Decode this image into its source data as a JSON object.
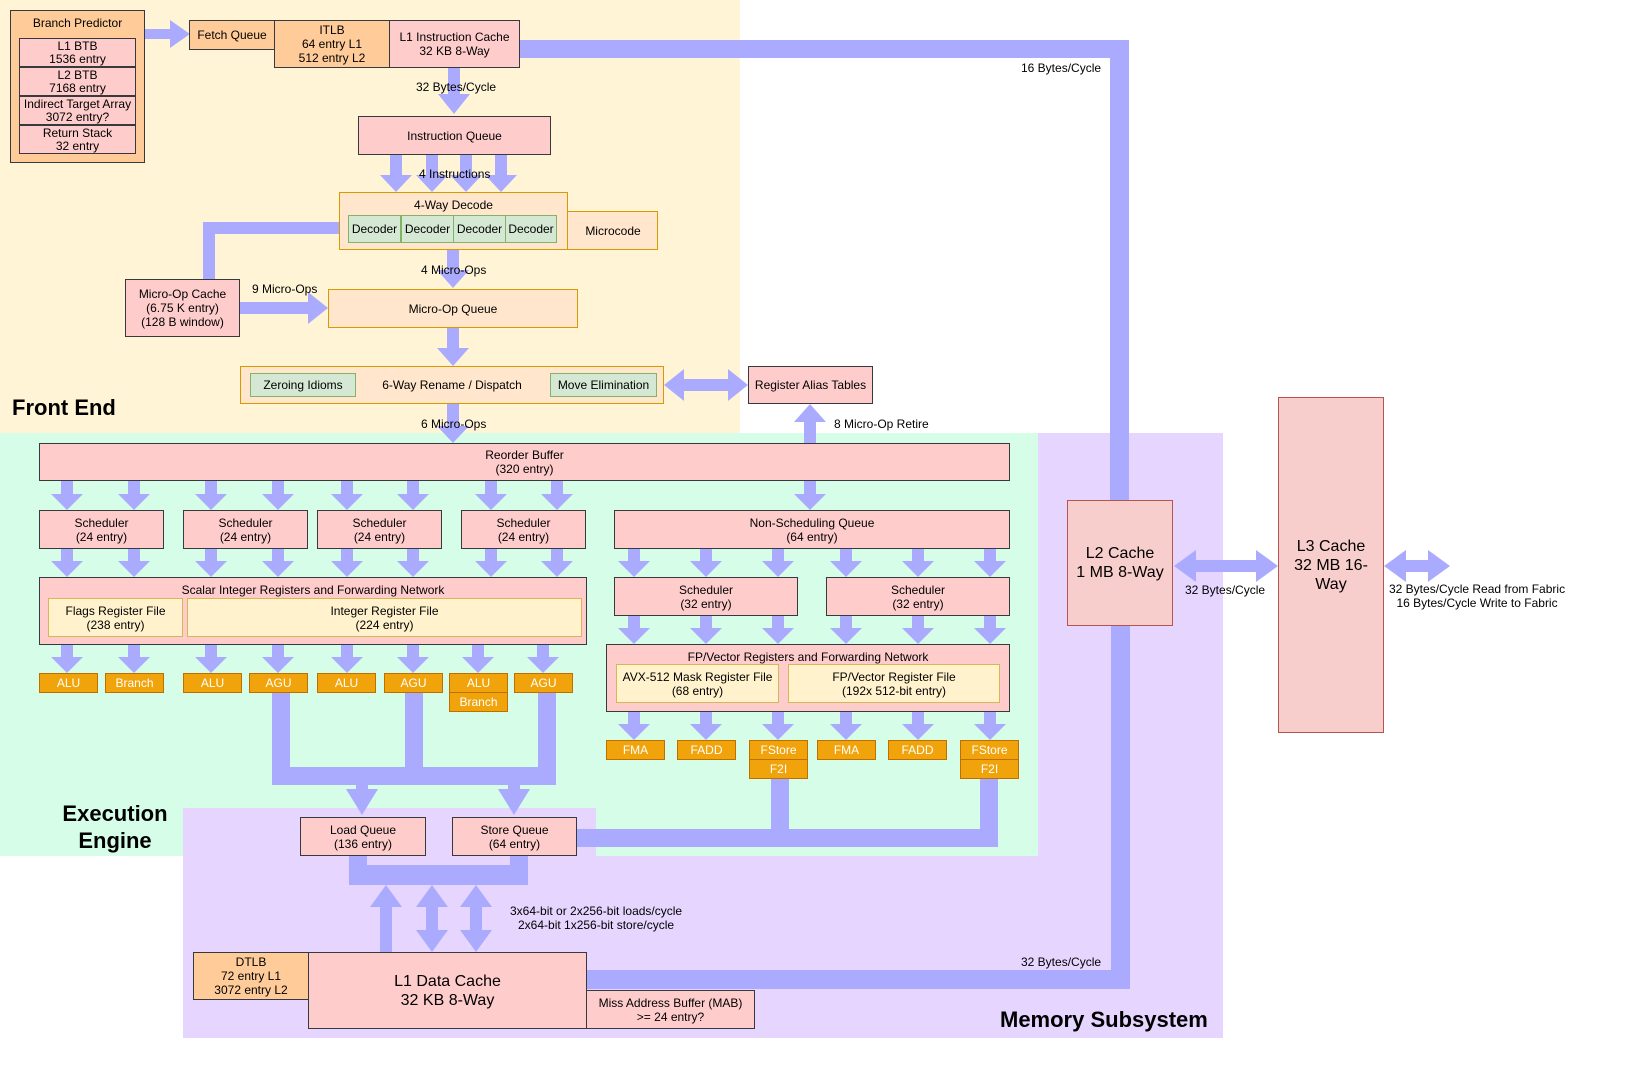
{
  "regions": {
    "front_end": "Front End",
    "execution_engine_line1": "Execution",
    "execution_engine_line2": "Engine",
    "memory_subsystem": "Memory Subsystem"
  },
  "colors": {
    "front_end_bg": "#fff5d6",
    "execution_bg": "#d5fde8",
    "memory_bg": "#e5d5ff",
    "arrow": "#aaaaff",
    "execution_unit": "#f0a30a"
  },
  "branch_predictor": {
    "title": "Branch Predictor",
    "entries": [
      {
        "line1": "L1 BTB",
        "line2": "1536 entry"
      },
      {
        "line1": "L2 BTB",
        "line2": "7168 entry"
      },
      {
        "line1": "Indirect Target Array",
        "line2": "3072 entry?"
      },
      {
        "line1": "Return Stack",
        "line2": "32 entry"
      }
    ]
  },
  "fetch_queue": "Fetch Queue",
  "itlb": {
    "line1": "ITLB",
    "line2": "64 entry L1",
    "line3": "512 entry L2"
  },
  "l1i": {
    "line1": "L1 Instruction Cache",
    "line2": "32 KB 8-Way"
  },
  "instruction_queue": "Instruction Queue",
  "decode": {
    "title": "4-Way Decode",
    "decoders": [
      "Decoder",
      "Decoder",
      "Decoder",
      "Decoder"
    ],
    "microcode": "Microcode"
  },
  "uop_cache": {
    "line1": "Micro-Op Cache",
    "line2": "(6.75 K entry)",
    "line3": "(128 B window)"
  },
  "uop_queue": "Micro-Op Queue",
  "rename": {
    "title": "6-Way Rename / Dispatch",
    "zeroing": "Zeroing Idioms",
    "move_elim": "Move Elimination"
  },
  "rat": "Register Alias Tables",
  "rob": {
    "line1": "Reorder Buffer",
    "line2": "(320 entry)"
  },
  "int_schedulers": [
    {
      "line1": "Scheduler",
      "line2": "(24 entry)"
    },
    {
      "line1": "Scheduler",
      "line2": "(24 entry)"
    },
    {
      "line1": "Scheduler",
      "line2": "(24 entry)"
    },
    {
      "line1": "Scheduler",
      "line2": "(24 entry)"
    }
  ],
  "nsq": {
    "line1": "Non-Scheduling Queue",
    "line2": "(64 entry)"
  },
  "fp_schedulers": [
    {
      "line1": "Scheduler",
      "line2": "(32 entry)"
    },
    {
      "line1": "Scheduler",
      "line2": "(32 entry)"
    }
  ],
  "int_regs": {
    "title": "Scalar Integer Registers and Forwarding Network",
    "flags": {
      "line1": "Flags Register File",
      "line2": "(238 entry)"
    },
    "irf": {
      "line1": "Integer Register File",
      "line2": "(224 entry)"
    }
  },
  "fp_regs": {
    "title": "FP/Vector Registers and Forwarding Network",
    "mask": {
      "line1": "AVX-512 Mask Register File",
      "line2": "(68 entry)"
    },
    "vrf": {
      "line1": "FP/Vector Register File",
      "line2": "(192x 512-bit entry)"
    }
  },
  "int_units": [
    "ALU",
    "Branch",
    "ALU",
    "AGU",
    "ALU",
    "AGU",
    "ALU",
    "AGU"
  ],
  "int_unit_extra": "Branch",
  "fp_units": [
    "FMA",
    "FADD",
    "FStore",
    "FMA",
    "FADD",
    "FStore"
  ],
  "fp_unit_extra": [
    "F2I",
    "F2I"
  ],
  "load_queue": {
    "line1": "Load Queue",
    "line2": "(136 entry)"
  },
  "store_queue": {
    "line1": "Store Queue",
    "line2": "(64 entry)"
  },
  "dtlb": {
    "line1": "DTLB",
    "line2": "72 entry L1",
    "line3": "3072 entry L2"
  },
  "l1d": {
    "line1": "L1 Data Cache",
    "line2": "32 KB 8-Way"
  },
  "mab": {
    "line1": "Miss Address Buffer (MAB)",
    "line2": ">= 24 entry?"
  },
  "l2": {
    "line1": "L2 Cache",
    "line2": "1 MB 8-Way"
  },
  "l3": {
    "line1": "L3 Cache",
    "line2": "32 MB 16-Way"
  },
  "labels": {
    "l1i_to_iq": "32 Bytes/Cycle",
    "l1i_to_l2": "16 Bytes/Cycle",
    "four_instr": "4 Instructions",
    "four_uops": "4 Micro-Ops",
    "nine_uops": "9 Micro-Ops",
    "six_uops": "6 Micro-Ops",
    "retire": "8 Micro-Op Retire",
    "l1d_bw_line1": "3x64-bit or 2x256-bit loads/cycle",
    "l1d_bw_line2": "2x64-bit 1x256-bit  store/cycle",
    "l1d_to_l2": "32 Bytes/Cycle",
    "l2_to_l3": "32 Bytes/Cycle",
    "fabric_line1": "32 Bytes/Cycle Read from Fabric",
    "fabric_line2": "16 Bytes/Cycle Write to Fabric"
  }
}
